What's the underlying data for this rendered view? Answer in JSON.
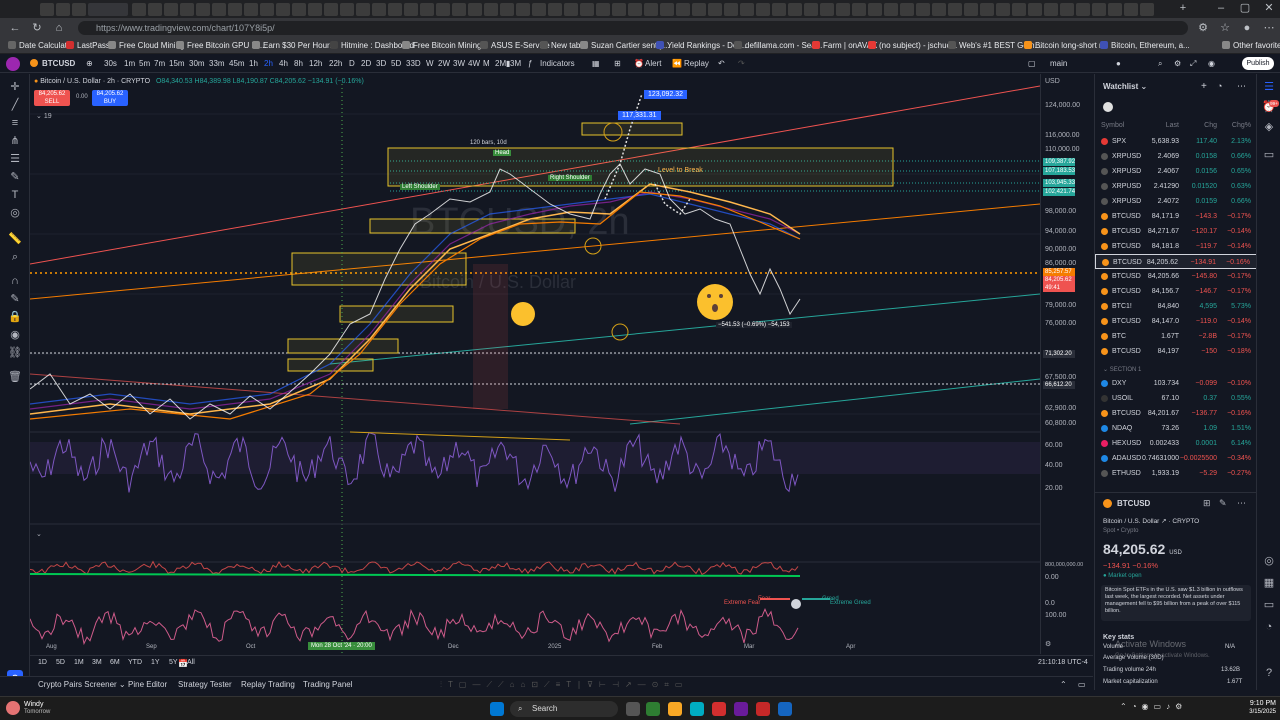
{
  "browser": {
    "url": "https://www.tradingview.com/chart/107Y8i5p/",
    "bookmarks": [
      "Date Calculator",
      "LastPass",
      "Free Cloud Mining",
      "Free Bitcoin GPU Mi...",
      "Earn $30 Per Hour...",
      "Hitmine : Dashboard",
      "Free Bitcoin Mining...",
      "ASUS E-Service",
      "New tab",
      "Suzan Cartier sent y...",
      "Yield Rankings - Def...",
      "defillama.com - Sea...",
      "Farm | onAVAX",
      "(no subject) - jschuc...",
      "Web's #1 BEST Gem...",
      "Bitcoin long-short r...",
      "Bitcoin, Ethereum, a...",
      "Other favorites"
    ]
  },
  "toolbar": {
    "symbol": "BTCUSD",
    "timeframes": [
      "30s",
      "1m",
      "5m",
      "7m",
      "15m",
      "30m",
      "33m",
      "45m",
      "1h",
      "2h",
      "4h",
      "8h",
      "12h",
      "22h",
      "D",
      "2D",
      "3D",
      "5D",
      "33D",
      "W",
      "2W",
      "3W",
      "4W",
      "M",
      "2M",
      "3M"
    ],
    "indicators_label": "Indicators",
    "alert_label": "Alert",
    "replay_label": "Replay",
    "layout_name": "main",
    "publish_label": "Publish"
  },
  "legend": {
    "title": "Bitcoin / U.S. Dollar · 2h · CRYPTO",
    "ohlc": "O84,340.53 H84,389.98 L84,190.87 C84,205.62 −134.91 (−0.16%)",
    "sell_price": "84,205.62",
    "sell_label": "SELL",
    "spread": "0.00",
    "buy_price": "84,205.62",
    "buy_label": "BUY",
    "indicator_count": "19"
  },
  "chart": {
    "currency": "USD",
    "price_ticks": [
      "124,000.00",
      "116,000.00",
      "110,000.00",
      "98,000.00",
      "94,000.00",
      "90,000.00",
      "86,000.00",
      "79,000.00",
      "76,000.00",
      "71,302.20",
      "67,500.00",
      "62,900.00",
      "60,800.00"
    ],
    "osc_ticks": [
      "60.00",
      "40.00",
      "20.00"
    ],
    "lower_ticks": [
      "800,000,000.00",
      "0.00",
      "100.00",
      "0.0"
    ],
    "price_labels": [
      {
        "text": "109,387.92",
        "color": "#26a69a"
      },
      {
        "text": "107,183.53",
        "color": "#26a69a"
      },
      {
        "text": "103,945.33",
        "color": "#26a69a"
      },
      {
        "text": "102,421.74",
        "color": "#26a69a"
      },
      {
        "text": "85,257.57",
        "color": "#f57c00"
      },
      {
        "text": "84,205.62",
        "color": "#ef5350"
      },
      {
        "text": "49:41",
        "color": "#ef5350"
      },
      {
        "text": "71,302.20",
        "color": "#434651"
      },
      {
        "text": "66,612.20",
        "color": "#434651"
      }
    ],
    "annotations": {
      "peak1": "123,092.32",
      "peak2": "117,331.31",
      "bars_note": "120 bars, 10d",
      "head": "Head",
      "left_shoulder": "Left Shoulder",
      "right_shoulder": "Right Shoulder",
      "level_to_break": "Level to Break",
      "measure": "−541.53 (−0.69%) −54,153",
      "fear": "Fear",
      "greed": "Greed",
      "extreme_fear": "Extreme Fear",
      "extreme_greed": "Extreme Greed"
    },
    "time_labels": [
      "Aug",
      "Sep",
      "Oct",
      "Mon 28 Oct '24 · 20:00",
      "Dec",
      "2025",
      "Feb",
      "Mar",
      "Apr"
    ],
    "watermark": "BTCUSD, 2h",
    "watermark2": "Bitcoin / U.S. Dollar"
  },
  "ranges": [
    "1D",
    "5D",
    "1M",
    "3M",
    "6M",
    "YTD",
    "1Y",
    "5Y",
    "All"
  ],
  "clock": "21:10:18 UTC-4",
  "bottom_tabs": [
    "Crypto Pairs Screener",
    "Pine Editor",
    "Strategy Tester",
    "Replay Trading",
    "Trading Panel"
  ],
  "watchlist": {
    "title": "Watchlist",
    "cols": [
      "Symbol",
      "Last",
      "Chg",
      "Chg%"
    ],
    "rows": [
      {
        "sym": "SPX",
        "last": "5,638.93",
        "chg": "117.40",
        "pct": "2.13%",
        "dir": "pos",
        "c": "#e53935"
      },
      {
        "sym": "XRPUSD",
        "last": "2.4069",
        "chg": "0.0158",
        "pct": "0.66%",
        "dir": "pos",
        "c": "#555"
      },
      {
        "sym": "XRPUSD",
        "last": "2.4067",
        "chg": "0.0156",
        "pct": "0.65%",
        "dir": "pos",
        "c": "#555"
      },
      {
        "sym": "XRPUSD",
        "last": "2.41290",
        "chg": "0.01520",
        "pct": "0.63%",
        "dir": "pos",
        "c": "#555"
      },
      {
        "sym": "XRPUSD",
        "last": "2.4072",
        "chg": "0.0159",
        "pct": "0.66%",
        "dir": "pos",
        "c": "#555"
      },
      {
        "sym": "BTCUSD",
        "last": "84,171.9",
        "chg": "−143.3",
        "pct": "−0.17%",
        "dir": "neg",
        "c": "#f7931a"
      },
      {
        "sym": "BTCUSD",
        "last": "84,271.67",
        "chg": "−120.17",
        "pct": "−0.14%",
        "dir": "neg",
        "c": "#f7931a"
      },
      {
        "sym": "BTCUSD",
        "last": "84,181.8",
        "chg": "−119.7",
        "pct": "−0.14%",
        "dir": "neg",
        "c": "#f7931a"
      },
      {
        "sym": "BTCUSD",
        "last": "84,205.62",
        "chg": "−134.91",
        "pct": "−0.16%",
        "dir": "neg",
        "c": "#f7931a",
        "sel": true
      },
      {
        "sym": "BTCUSD",
        "last": "84,205.66",
        "chg": "−145.80",
        "pct": "−0.17%",
        "dir": "neg",
        "c": "#f7931a"
      },
      {
        "sym": "BTCUSD",
        "last": "84,156.7",
        "chg": "−146.7",
        "pct": "−0.17%",
        "dir": "neg",
        "c": "#f7931a"
      },
      {
        "sym": "BTC1!",
        "last": "84,840",
        "chg": "4,595",
        "pct": "5.73%",
        "dir": "pos",
        "c": "#f7931a"
      },
      {
        "sym": "BTCUSD",
        "last": "84,147.0",
        "chg": "−119.0",
        "pct": "−0.14%",
        "dir": "neg",
        "c": "#f7931a"
      },
      {
        "sym": "BTC",
        "last": "1.67T",
        "chg": "−2.8B",
        "pct": "−0.17%",
        "dir": "neg",
        "c": "#f7931a"
      },
      {
        "sym": "BTCUSD",
        "last": "84,197",
        "chg": "−150",
        "pct": "−0.18%",
        "dir": "neg",
        "c": "#f7931a"
      }
    ],
    "section": "SECTION 1",
    "rows2": [
      {
        "sym": "DXY",
        "last": "103.734",
        "chg": "−0.099",
        "pct": "−0.10%",
        "dir": "neg",
        "c": "#1e88e5"
      },
      {
        "sym": "USOIL",
        "last": "67.10",
        "chg": "0.37",
        "pct": "0.55%",
        "dir": "pos",
        "c": "#333"
      },
      {
        "sym": "BTCUSD",
        "last": "84,201.67",
        "chg": "−136.77",
        "pct": "−0.16%",
        "dir": "neg",
        "c": "#f7931a"
      },
      {
        "sym": "NDAQ",
        "last": "73.26",
        "chg": "1.09",
        "pct": "1.51%",
        "dir": "pos",
        "c": "#1e88e5"
      },
      {
        "sym": "HEXUSD",
        "last": "0.002433",
        "chg": "0.0001",
        "pct": "6.14%",
        "dir": "pos",
        "c": "#e91e63"
      },
      {
        "sym": "ADAUSD",
        "last": "0.74631000",
        "chg": "−0.0025500",
        "pct": "−0.34%",
        "dir": "neg",
        "c": "#1e88e5"
      },
      {
        "sym": "ETHUSD",
        "last": "1,933.19",
        "chg": "−5.29",
        "pct": "−0.27%",
        "dir": "neg",
        "c": "#555"
      }
    ]
  },
  "detail": {
    "symbol": "BTCUSD",
    "name": "Bitcoin / U.S. Dollar",
    "exchange": "CRYPTO",
    "type": "Spot • Crypto",
    "price": "84,205.62",
    "currency": "USD",
    "change": "−134.91 −0.16%",
    "market": "Market open",
    "news": "Bitcoin Spot ETFs in the U.S. saw $1.3 billion in outflows last week, the largest recorded. Net assets under management fell to $95 billion from a peak of over $115 billion.",
    "key_stats": "Key stats",
    "volume_label": "Volume",
    "volume": "N/A",
    "avg_vol_label": "Average Volume (30D)",
    "tv24_label": "Trading volume 24h",
    "tv24": "13.62B",
    "mcap_label": "Market capitalization",
    "mcap": "1.67T",
    "activate1": "Activate Windows",
    "activate2": "Go to Settings to activate Windows."
  },
  "taskbar": {
    "weather": "Windy",
    "weather_sub": "Tomorrow",
    "search": "Search",
    "time": "9:10 PM",
    "date": "3/15/2025"
  }
}
